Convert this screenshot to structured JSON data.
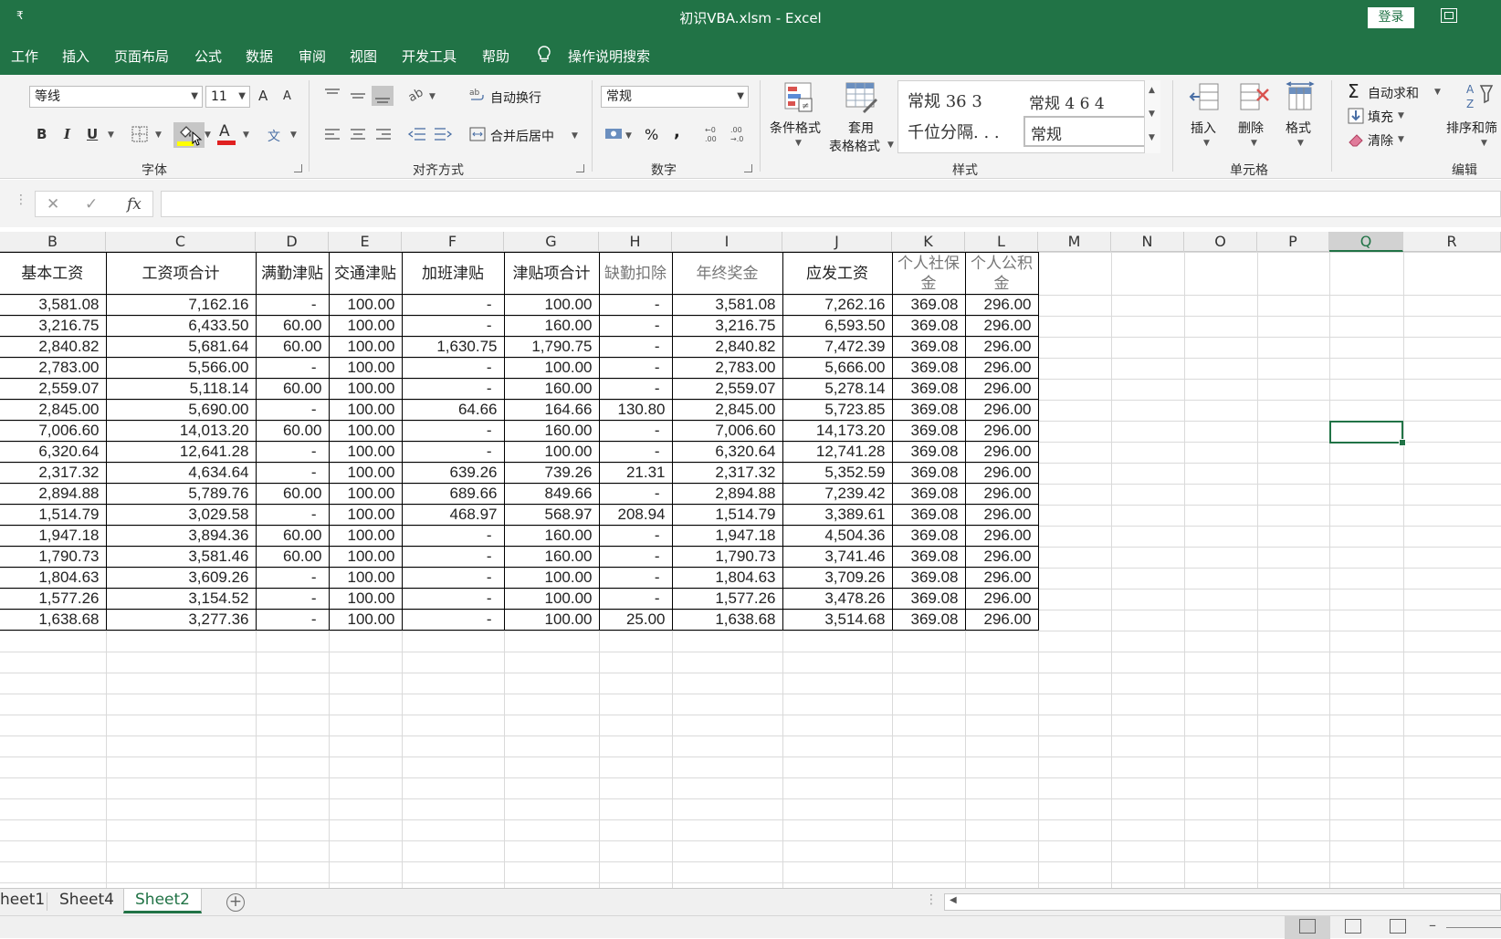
{
  "window": {
    "title": "初识VBA.xlsm  -  Excel",
    "login_label": "登录",
    "qa_glyph": "₹"
  },
  "menu": {
    "items": [
      "工作",
      "插入",
      "页面布局",
      "公式",
      "数据",
      "审阅",
      "视图",
      "开发工具",
      "帮助"
    ],
    "tell_me": "操作说明搜索"
  },
  "ribbon": {
    "font": {
      "name": "等线",
      "size": "11",
      "grow": "A",
      "shrink": "A",
      "bold": "B",
      "italic": "I",
      "underline": "U",
      "font_color": "A",
      "phonetic": "文",
      "label": "字体"
    },
    "alignment": {
      "wrap_text": "自动换行",
      "merge_center": "合并后居中",
      "label": "对齐方式"
    },
    "number": {
      "format": "常规",
      "percent": "%",
      "comma": ",",
      "label": "数字"
    },
    "styles": {
      "conditional": "条件格式",
      "table_fmt_1": "套用",
      "table_fmt_2": "表格格式",
      "cell_1": "常规 36 3",
      "cell_2": "常规 4 6 4",
      "cell_3": "千位分隔. . .",
      "cell_4": "常规",
      "label": "样式"
    },
    "cells": {
      "insert": "插入",
      "delete": "删除",
      "format": "格式",
      "label": "单元格"
    },
    "editing": {
      "autosum": "自动求和",
      "fill": "填充",
      "clear": "清除",
      "sort": "排序和筛",
      "label": "编辑"
    }
  },
  "formula_bar": {
    "cancel": "✕",
    "enter": "✓",
    "fx": "fx",
    "content": ""
  },
  "grid": {
    "columns": [
      "B",
      "C",
      "D",
      "E",
      "F",
      "G",
      "H",
      "I",
      "J",
      "K",
      "L",
      "M",
      "N",
      "O",
      "P",
      "Q",
      "R"
    ],
    "selected_column": "Q",
    "headers": [
      "基本工资",
      "工资项合计",
      "满勤津贴",
      "交通津贴",
      "加班津贴",
      "津贴项合计",
      "缺勤扣除",
      "年终奖金",
      "应发工资",
      "个人社保金",
      "个人公积金"
    ],
    "rows": [
      [
        "3,581.08",
        "7,162.16",
        "-",
        "100.00",
        "-",
        "100.00",
        "-",
        "3,581.08",
        "7,262.16",
        "369.08",
        "296.00"
      ],
      [
        "3,216.75",
        "6,433.50",
        "60.00",
        "100.00",
        "-",
        "160.00",
        "-",
        "3,216.75",
        "6,593.50",
        "369.08",
        "296.00"
      ],
      [
        "2,840.82",
        "5,681.64",
        "60.00",
        "100.00",
        "1,630.75",
        "1,790.75",
        "-",
        "2,840.82",
        "7,472.39",
        "369.08",
        "296.00"
      ],
      [
        "2,783.00",
        "5,566.00",
        "-",
        "100.00",
        "-",
        "100.00",
        "-",
        "2,783.00",
        "5,666.00",
        "369.08",
        "296.00"
      ],
      [
        "2,559.07",
        "5,118.14",
        "60.00",
        "100.00",
        "-",
        "160.00",
        "-",
        "2,559.07",
        "5,278.14",
        "369.08",
        "296.00"
      ],
      [
        "2,845.00",
        "5,690.00",
        "-",
        "100.00",
        "64.66",
        "164.66",
        "130.80",
        "2,845.00",
        "5,723.85",
        "369.08",
        "296.00"
      ],
      [
        "7,006.60",
        "14,013.20",
        "60.00",
        "100.00",
        "-",
        "160.00",
        "-",
        "7,006.60",
        "14,173.20",
        "369.08",
        "296.00"
      ],
      [
        "6,320.64",
        "12,641.28",
        "-",
        "100.00",
        "-",
        "100.00",
        "-",
        "6,320.64",
        "12,741.28",
        "369.08",
        "296.00"
      ],
      [
        "2,317.32",
        "4,634.64",
        "-",
        "100.00",
        "639.26",
        "739.26",
        "21.31",
        "2,317.32",
        "5,352.59",
        "369.08",
        "296.00"
      ],
      [
        "2,894.88",
        "5,789.76",
        "60.00",
        "100.00",
        "689.66",
        "849.66",
        "-",
        "2,894.88",
        "7,239.42",
        "369.08",
        "296.00"
      ],
      [
        "1,514.79",
        "3,029.58",
        "-",
        "100.00",
        "468.97",
        "568.97",
        "208.94",
        "1,514.79",
        "3,389.61",
        "369.08",
        "296.00"
      ],
      [
        "1,947.18",
        "3,894.36",
        "60.00",
        "100.00",
        "-",
        "160.00",
        "-",
        "1,947.18",
        "4,504.36",
        "369.08",
        "296.00"
      ],
      [
        "1,790.73",
        "3,581.46",
        "60.00",
        "100.00",
        "-",
        "160.00",
        "-",
        "1,790.73",
        "3,741.46",
        "369.08",
        "296.00"
      ],
      [
        "1,804.63",
        "3,609.26",
        "-",
        "100.00",
        "-",
        "100.00",
        "-",
        "1,804.63",
        "3,709.26",
        "369.08",
        "296.00"
      ],
      [
        "1,577.26",
        "3,154.52",
        "-",
        "100.00",
        "-",
        "100.00",
        "-",
        "1,577.26",
        "3,478.26",
        "369.08",
        "296.00"
      ],
      [
        "1,638.68",
        "3,277.36",
        "-",
        "100.00",
        "-",
        "100.00",
        "25.00",
        "1,638.68",
        "3,514.68",
        "369.08",
        "296.00"
      ]
    ]
  },
  "sheets": {
    "tabs": [
      "heet1",
      "Sheet4",
      "Sheet2"
    ],
    "active": "Sheet2",
    "add": "+"
  },
  "colors": {
    "accent": "#217346",
    "highlight_yellow": "#ffff00",
    "font_red": "#e02020"
  }
}
